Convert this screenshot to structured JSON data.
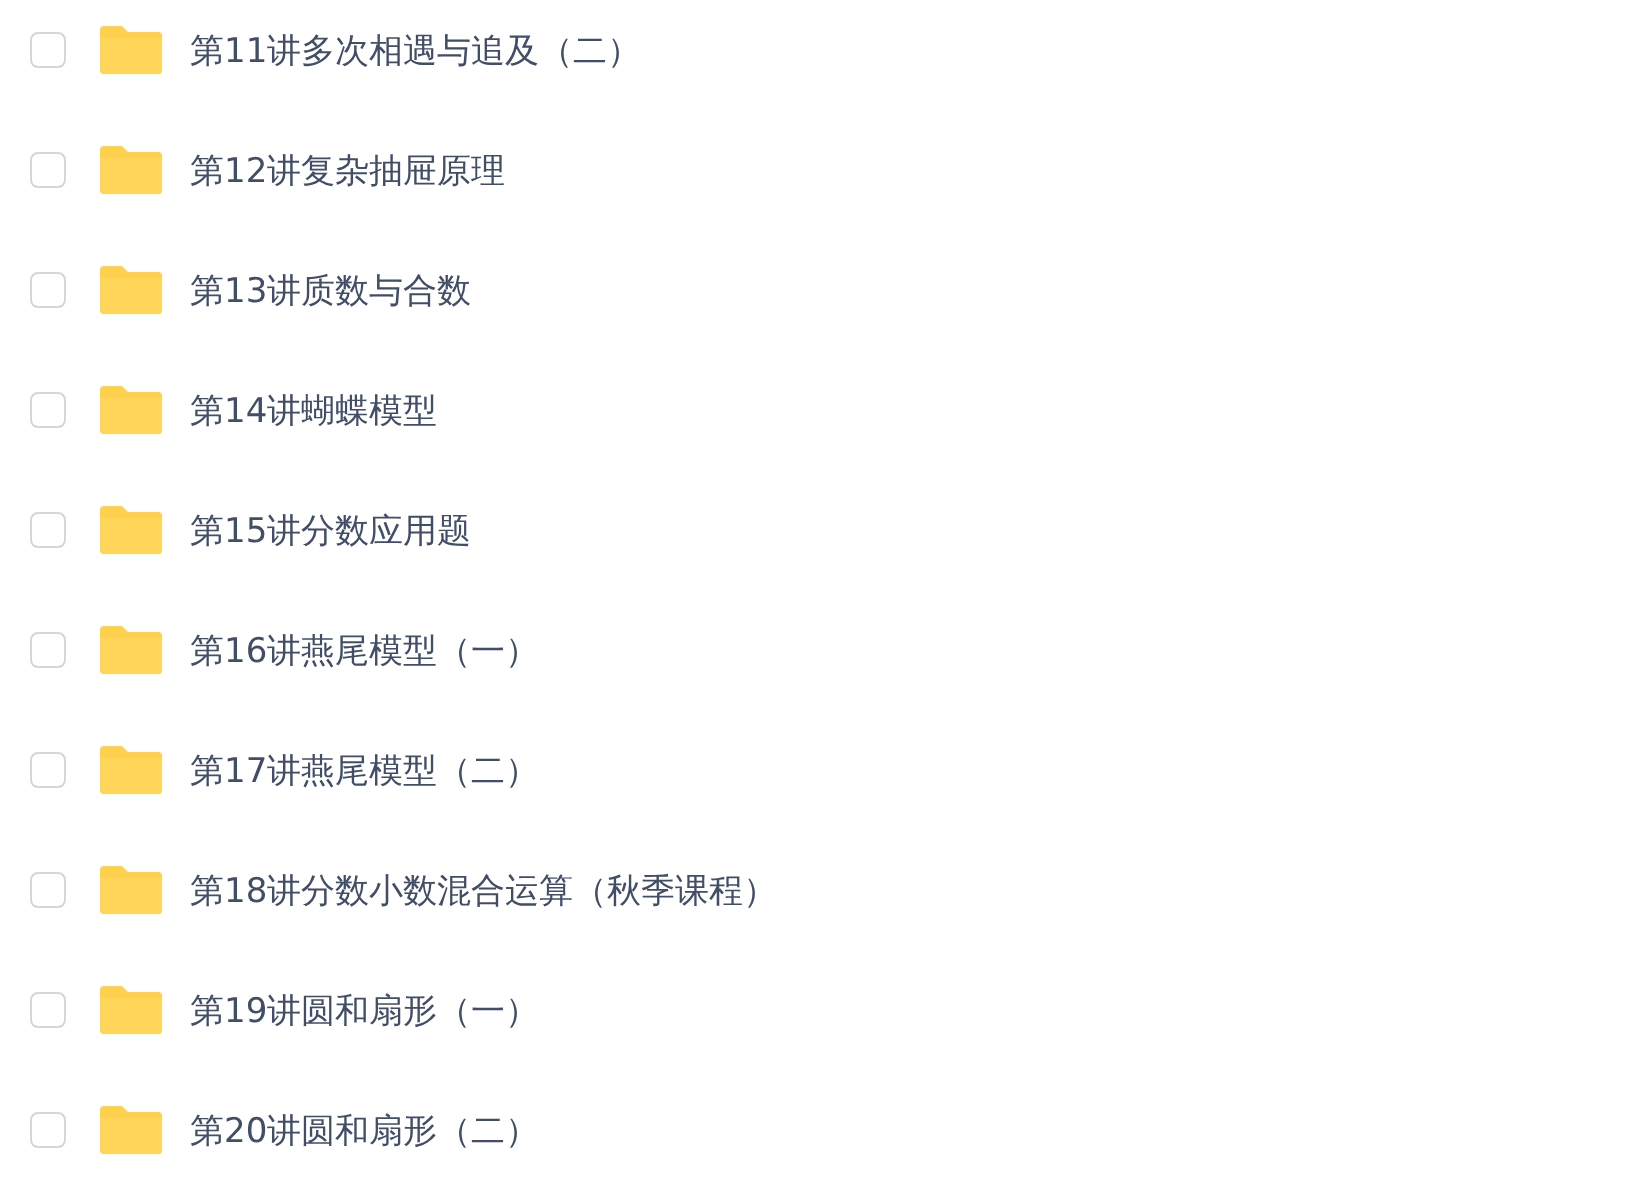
{
  "folders": [
    {
      "name": "第11讲多次相遇与追及（二）",
      "checked": false
    },
    {
      "name": "第12讲复杂抽屉原理",
      "checked": false
    },
    {
      "name": "第13讲质数与合数",
      "checked": false
    },
    {
      "name": "第14讲蝴蝶模型",
      "checked": false
    },
    {
      "name": "第15讲分数应用题",
      "checked": false
    },
    {
      "name": "第16讲燕尾模型（一）",
      "checked": false
    },
    {
      "name": "第17讲燕尾模型（二）",
      "checked": false
    },
    {
      "name": "第18讲分数小数混合运算（秋季课程）",
      "checked": false
    },
    {
      "name": "第19讲圆和扇形（一）",
      "checked": false
    },
    {
      "name": "第20讲圆和扇形（二）",
      "checked": false
    }
  ]
}
